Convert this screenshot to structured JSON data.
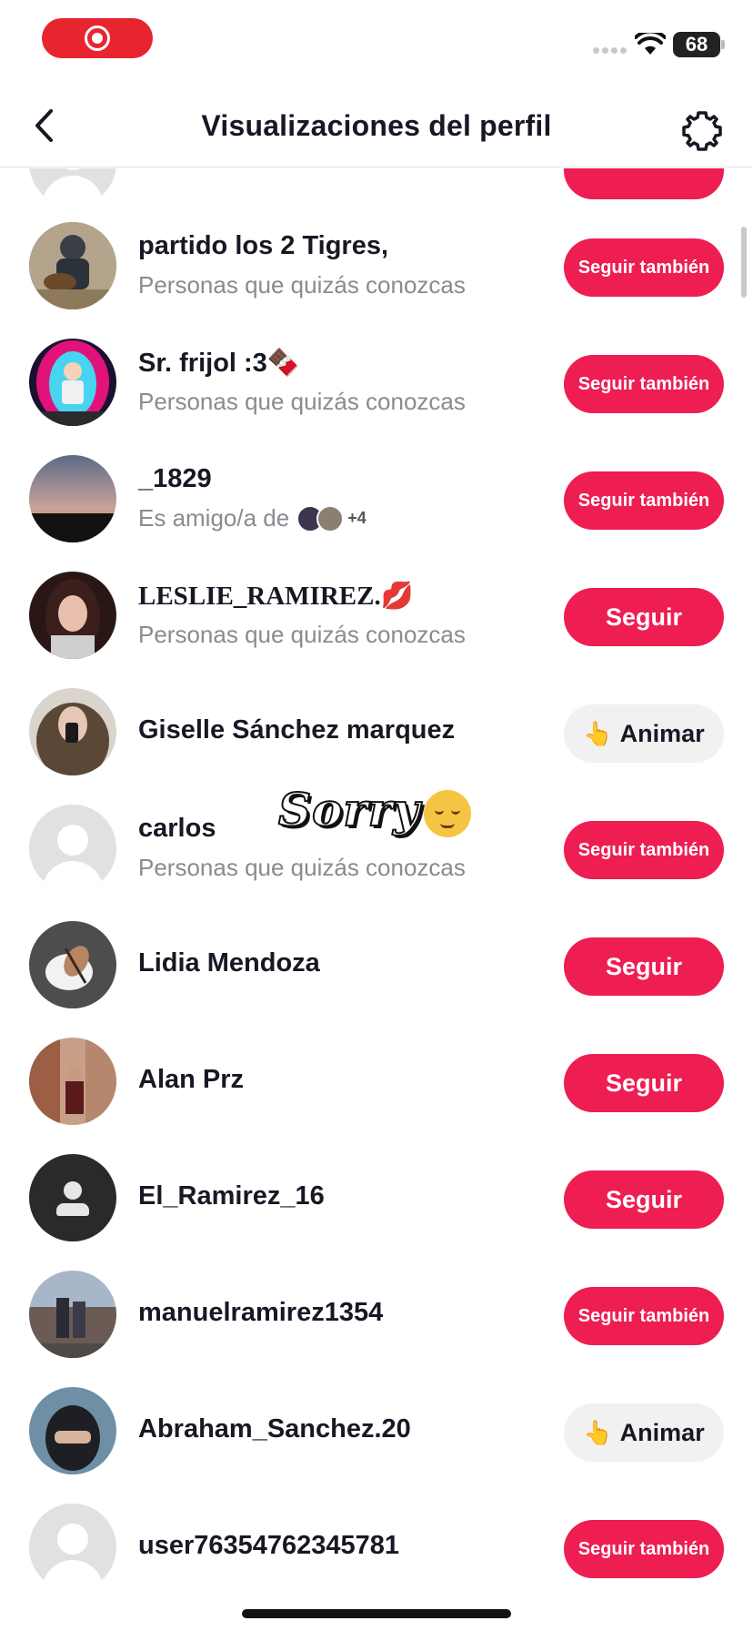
{
  "status_bar": {
    "battery": "68"
  },
  "header": {
    "title": "Visualizaciones del perfil"
  },
  "colors": {
    "accent": "#ee1d52",
    "secondary_text": "#8a8b91",
    "recording": "#e8242f"
  },
  "rows": [
    {
      "name": "partido los 2 Tigres,",
      "subtitle": "Personas que quizás conozcas",
      "action": "Seguir también"
    },
    {
      "name": "Sr. frijol :3🍫",
      "subtitle": "Personas que quizás conozcas",
      "action": "Seguir también"
    },
    {
      "name": "_1829",
      "subtitle": "Es amigo/a de",
      "mutual_more": "+4",
      "action": "Seguir también"
    },
    {
      "name": "LESLIE_RAMIREZ.💋",
      "subtitle": "Personas que quizás conozcas",
      "action": "Seguir"
    },
    {
      "name": "Giselle Sánchez marquez",
      "action": "Animar"
    },
    {
      "name": "carlos",
      "subtitle": "Personas que quizás conozcas",
      "action": "Seguir también"
    },
    {
      "name": "Lidia Mendoza",
      "action": "Seguir"
    },
    {
      "name": "Alan Prz",
      "action": "Seguir"
    },
    {
      "name": "El_Ramirez_16",
      "action": "Seguir"
    },
    {
      "name": "manuelramirez1354",
      "action": "Seguir también"
    },
    {
      "name": "Abraham_Sanchez.20",
      "action": "Animar"
    },
    {
      "name": "user76354762345781",
      "action": "Seguir también"
    }
  ],
  "sticker": {
    "text": "Sorry"
  },
  "icons": {
    "back": "chevron-left-icon",
    "settings": "gear-icon",
    "cheer": "pointing-hand-icon"
  }
}
